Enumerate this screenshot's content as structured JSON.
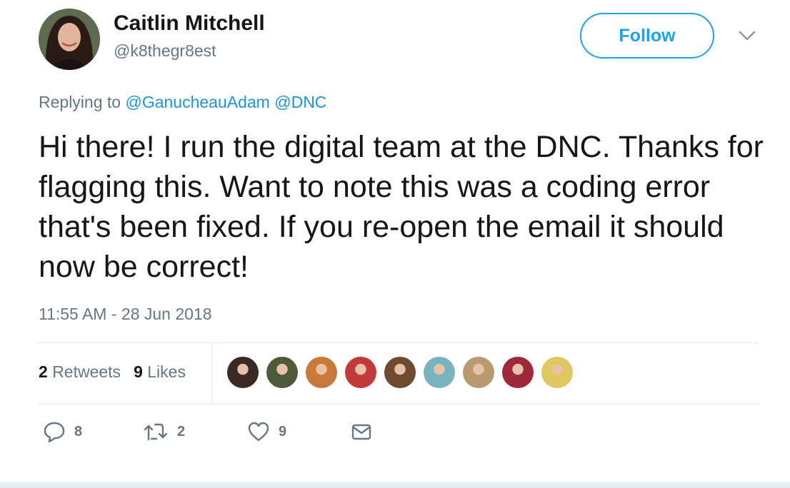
{
  "author": {
    "name": "Caitlin Mitchell",
    "handle": "@k8thegr8est"
  },
  "follow_button": "Follow",
  "reply": {
    "prefix": "Replying to",
    "mentions": [
      "@GanucheauAdam",
      "@DNC"
    ]
  },
  "tweet_text": "Hi there! I run the digital team at the DNC. Thanks for flagging this. Want to note this was a coding error that's been fixed. If you re-open the email it should now be correct!",
  "timestamp": "11:55 AM - 28 Jun 2018",
  "stats": {
    "retweets_count": "2",
    "retweets_label": "Retweets",
    "likes_count": "9",
    "likes_label": "Likes"
  },
  "likers": [
    {
      "color": "#3a2a24"
    },
    {
      "color": "#4f5a3a"
    },
    {
      "color": "#c97a3a"
    },
    {
      "color": "#c23a3a"
    },
    {
      "color": "#6d4a30"
    },
    {
      "color": "#7ab3c0"
    },
    {
      "color": "#b89a70"
    },
    {
      "color": "#a0283c"
    },
    {
      "color": "#e0c860"
    }
  ],
  "actions": {
    "reply_count": "8",
    "retweet_count": "2",
    "like_count": "9"
  },
  "colors": {
    "accent": "#1da1f2",
    "secondary_text": "#657786",
    "primary_text": "#14171a"
  }
}
